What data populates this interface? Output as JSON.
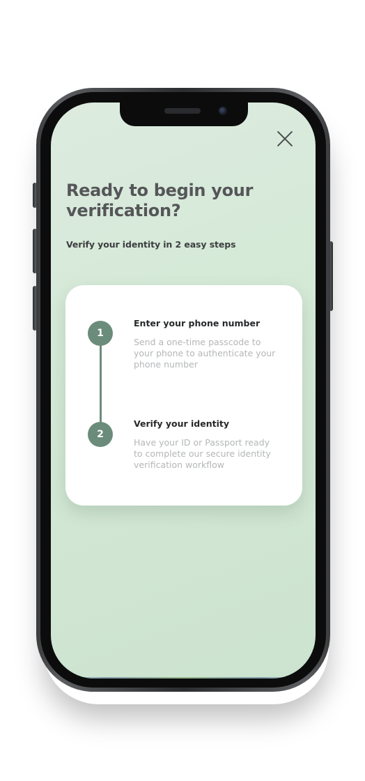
{
  "modal": {
    "title": "Ready to begin your verification?",
    "subtitle": "Verify your identity in 2 easy steps",
    "close_icon": "close-icon"
  },
  "steps": [
    {
      "number": "1",
      "title": "Enter your phone number",
      "description": "Send a one-time passcode to your phone to authenticate your phone number"
    },
    {
      "number": "2",
      "title": "Verify your identity",
      "description": "Have your ID or Passport ready to complete our secure identity verification workflow"
    }
  ],
  "colors": {
    "screen_background": "#d4e9d6",
    "step_accent": "#6b8c7b",
    "title_text": "#555659",
    "description_text": "#b4b6b8",
    "card_background": "#ffffff",
    "device_frame": "#2c2d2f"
  }
}
